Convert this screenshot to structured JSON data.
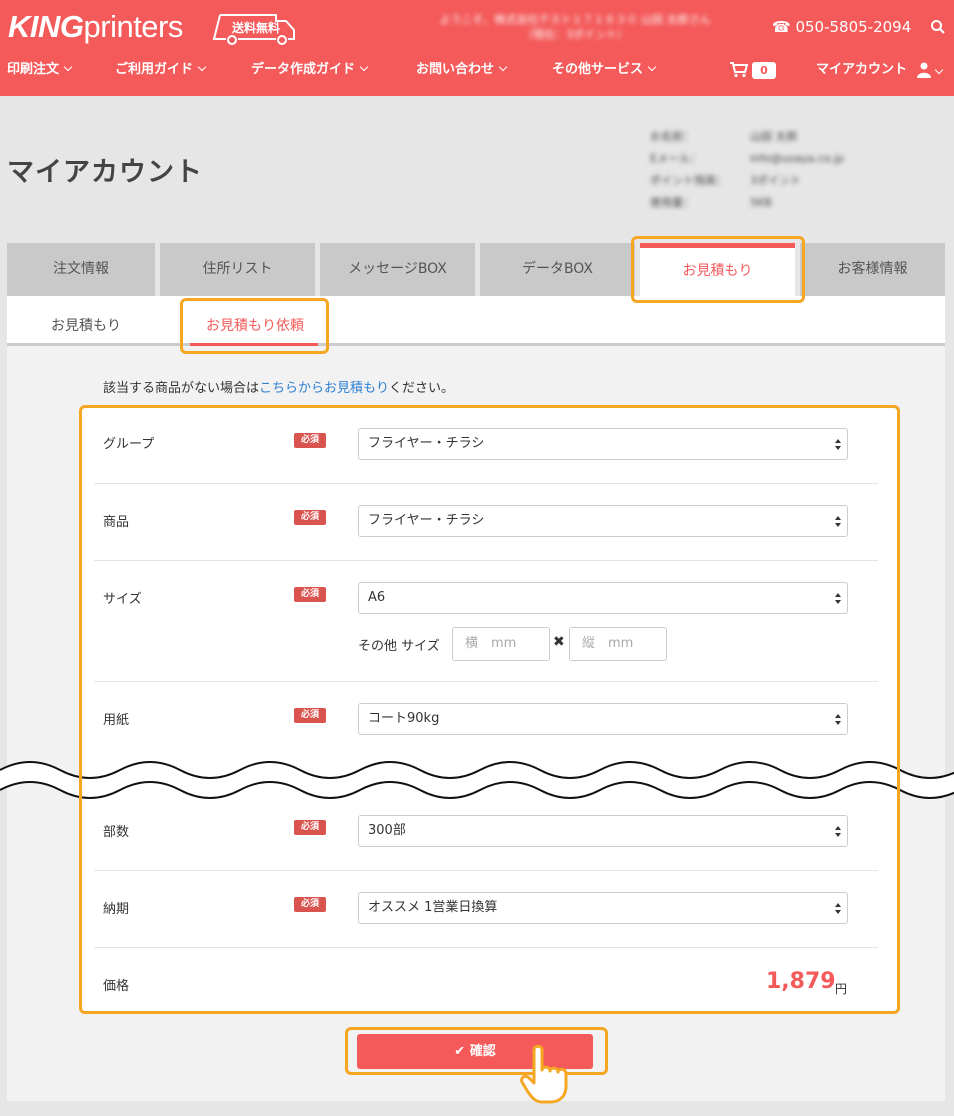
{
  "header": {
    "logo_king": "KING",
    "logo_printers": "printers",
    "free_shipping": "送料無料",
    "welcome_line1": "ようこそ、株式会社テスト１７１６３０ 山田 太郎さん",
    "welcome_line2": "（現在：3ポイント）",
    "phone": "050-5805-2094",
    "nav": [
      "印刷注文",
      "ご利用ガイド",
      "データ作成ガイド",
      "お問い合わせ",
      "その他サービス"
    ],
    "cart_count": "0",
    "account": "マイアカウント"
  },
  "page": {
    "title": "マイアカウント",
    "info": [
      {
        "label": "お名前：",
        "value": "山田 太郎"
      },
      {
        "label": "Eメール：",
        "value": "info@usaya.co.jp"
      },
      {
        "label": "ポイント残高：",
        "value": "3ポイント"
      },
      {
        "label": "使用量：",
        "value": "5KB"
      }
    ]
  },
  "tabs": [
    "注文情報",
    "住所リスト",
    "メッセージBOX",
    "データBOX",
    "お見積もり",
    "お客様情報"
  ],
  "subtabs": [
    "お見積もり",
    "お見積もり依頼"
  ],
  "notice": {
    "before": "該当する商品がない場合は",
    "link": "こちらからお見積もり",
    "after": "ください。"
  },
  "required_label": "必須",
  "form": {
    "group": {
      "label": "グループ",
      "value": "フライヤー・チラシ"
    },
    "product": {
      "label": "商品",
      "value": "フライヤー・チラシ"
    },
    "size": {
      "label": "サイズ",
      "value": "A6",
      "other_label": "その他 サイズ",
      "width_placeholder": "横　mm",
      "height_placeholder": "縦　mm",
      "times": "✖"
    },
    "paper": {
      "label": "用紙",
      "value": "コート90kg"
    },
    "quantity": {
      "label": "部数",
      "value": "300部"
    },
    "delivery": {
      "label": "納期",
      "value": "オススメ 1営業日換算"
    },
    "price": {
      "label": "価格",
      "value": "1,879",
      "unit": "円"
    }
  },
  "confirm_button": "✔ 確認",
  "colors": {
    "brand": "#f45a5a",
    "highlight": "#f5a623",
    "link": "#2d7fd3"
  }
}
